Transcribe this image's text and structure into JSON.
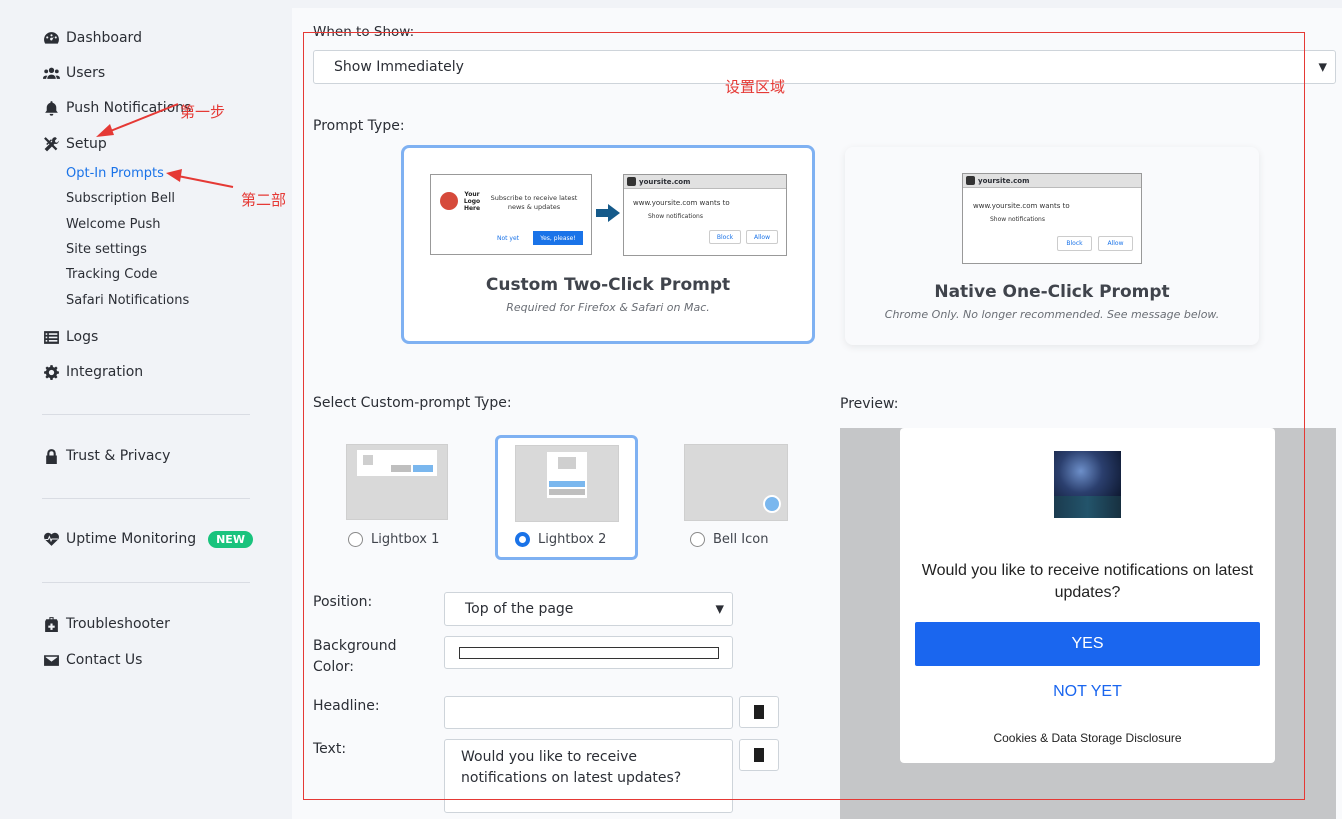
{
  "sidebar": {
    "items": [
      {
        "label": "Dashboard",
        "icon": "dashboard-icon"
      },
      {
        "label": "Users",
        "icon": "users-icon"
      },
      {
        "label": "Push Notifications",
        "icon": "bell-icon"
      },
      {
        "label": "Setup",
        "icon": "tools-icon"
      }
    ],
    "setup_sub": [
      "Opt-In Prompts",
      "Subscription Bell",
      "Welcome Push",
      "Site settings",
      "Tracking Code",
      "Safari Notifications"
    ],
    "logs": "Logs",
    "integration": "Integration",
    "trust": "Trust & Privacy",
    "uptime": "Uptime Monitoring",
    "uptime_badge": "NEW",
    "troubleshooter": "Troubleshooter",
    "contact": "Contact Us"
  },
  "main": {
    "when_label": "When to Show:",
    "when_value": "Show Immediately",
    "prompt_type_label": "Prompt Type:",
    "custom_prompt": {
      "title": "Custom Two-Click Prompt",
      "subtitle": "Required for Firefox & Safari on Mac.",
      "logo_text": "Your Logo Here",
      "subscribe_text": "Subscribe to receive latest news & updates",
      "not_yet": "Not yet",
      "yes_please": "Yes, please!",
      "site": "yoursite.com",
      "wants_to": "www.yoursite.com wants to",
      "show_notifications": "Show notifications",
      "block": "Block",
      "allow": "Allow"
    },
    "native_prompt": {
      "title": "Native One-Click Prompt",
      "subtitle": "Chrome Only. No longer recommended. See message below.",
      "site": "yoursite.com",
      "wants_to": "www.yoursite.com wants to",
      "show_notifications": "Show notifications",
      "block": "Block",
      "allow": "Allow"
    },
    "custom_type_label": "Select Custom-prompt Type:",
    "types": [
      "Lightbox 1",
      "Lightbox 2",
      "Bell Icon"
    ],
    "selected_type": "Lightbox 2",
    "position_label": "Position:",
    "position_value": "Top of the page",
    "bg_label_1": "Background",
    "bg_label_2": "Color:",
    "headline_label": "Headline:",
    "text_label": "Text:",
    "text_value": "Would you like to receive notifications on latest updates?",
    "preview_label": "Preview:"
  },
  "preview": {
    "question": "Would you like to receive notifications on latest updates?",
    "yes": "YES",
    "no": "NOT YET",
    "disclosure": "Cookies & Data Storage Disclosure"
  },
  "annotations": {
    "step1": "第一步",
    "step2": "第二部",
    "settings_area": "设置区域"
  },
  "colors": {
    "accent": "#1a73e8",
    "preview_button": "#1a66ef",
    "annotation": "#e53935",
    "new_badge": "#19c37d"
  }
}
